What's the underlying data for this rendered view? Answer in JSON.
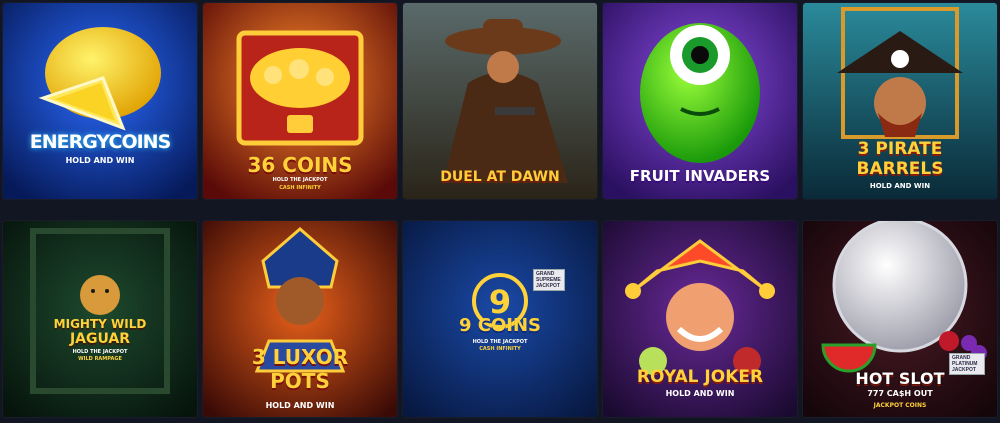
{
  "games": [
    {
      "title": "ENERGYCOINS",
      "subtitle": "HOLD AND WIN"
    },
    {
      "title": "36 COINS",
      "subtitle": "HOLD THE JACKPOT",
      "subtitle2": "CASH INFINITY"
    },
    {
      "title": "DUEL AT DAWN"
    },
    {
      "title": "FRUIT INVADERS"
    },
    {
      "title_top": "3 PIRATE",
      "title_bottom": "BARRELS",
      "subtitle": "HOLD AND WIN"
    },
    {
      "title_top": "MIGHTY WILD",
      "title_bottom": "JAGUAR",
      "subtitle": "HOLD THE JACKPOT",
      "subtitle2": "WILD RAMPAGE"
    },
    {
      "title_top": "3 LUXOR",
      "title_bottom": "POTS",
      "subtitle": "HOLD AND WIN"
    },
    {
      "title": "9 COINS",
      "subtitle": "HOLD THE JACKPOT",
      "subtitle2": "CASH INFINITY",
      "badge": "GRAND SUPREME JACKPOT"
    },
    {
      "title": "ROYAL JOKER",
      "subtitle": "HOLD AND WIN"
    },
    {
      "title": "HOT SLOT",
      "subtitle": "777 CA$H OUT",
      "subtitle2": "JACKPOT COINS",
      "badge": "GRAND PLATINUM JACKPOT"
    }
  ],
  "colors": {
    "page_background": "#121623",
    "energy_coins": "#0b2a8a",
    "36_coins": "#8a1a12",
    "duel_at_dawn": "#3a4a48",
    "fruit_invaders": "#4a2a90",
    "pirate_barrels": "#1a5a6a",
    "mighty_wild_jaguar": "#0e2a1c",
    "luxor_pots": "#7a2a10",
    "9_coins": "#0c2a6a",
    "royal_joker": "#3a1a5a",
    "hot_slot": "#2a0e12"
  }
}
